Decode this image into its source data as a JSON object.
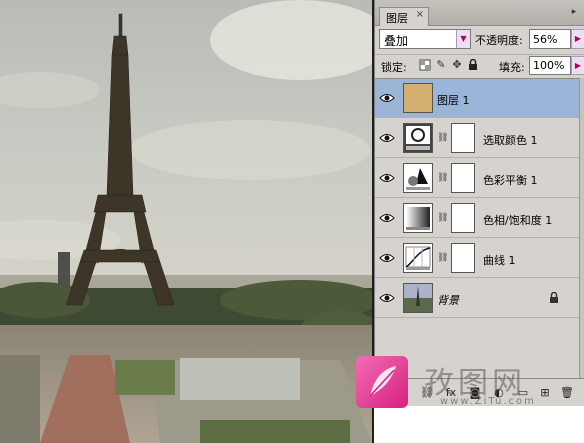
{
  "panel": {
    "tab_label": "图层",
    "tab_close": "×",
    "menu_glyph": "▸",
    "blend_mode": "叠加",
    "opacity_label": "不透明度:",
    "opacity_value": "56%",
    "lock_label": "锁定:",
    "fill_label": "填充:",
    "fill_value": "100%"
  },
  "layers": [
    {
      "name": "图层 1",
      "type": "fill",
      "active": true,
      "thumb_color": "#d4b071"
    },
    {
      "name": "选取颜色 1",
      "type": "adjustment",
      "icon": "selective-color-icon"
    },
    {
      "name": "色彩平衡 1",
      "type": "adjustment",
      "icon": "color-balance-icon"
    },
    {
      "name": "色相/饱和度 1",
      "type": "adjustment",
      "icon": "hue-saturation-icon"
    },
    {
      "name": "曲线 1",
      "type": "adjustment",
      "icon": "curves-icon"
    },
    {
      "name": "背景",
      "type": "background",
      "locked": true
    }
  ],
  "watermark": {
    "brand": "孜图网",
    "url": "www.ZiTu.com"
  },
  "colors": {
    "panel_bg": "#d6d3ce",
    "active_layer": "#9bb5d9",
    "watermark_pink": "#e83d96"
  }
}
